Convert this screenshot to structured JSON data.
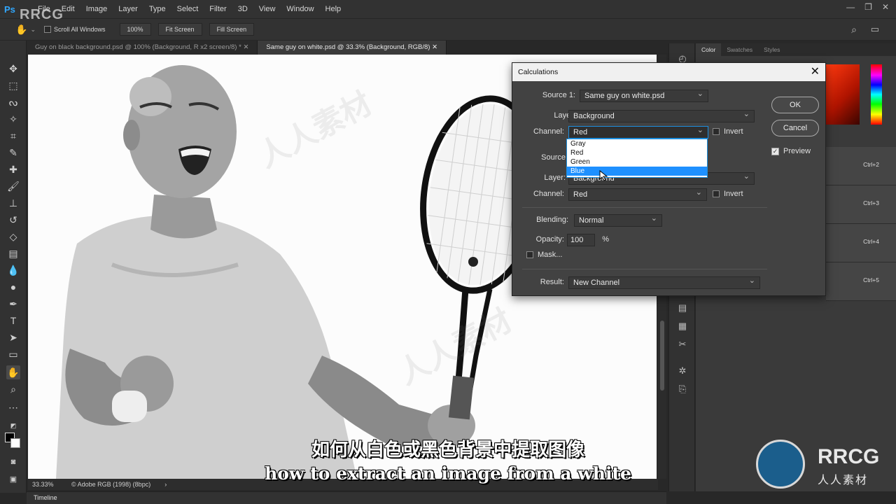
{
  "app": {
    "logo": "Ps"
  },
  "menu": [
    "File",
    "Edit",
    "Image",
    "Layer",
    "Type",
    "Select",
    "Filter",
    "3D",
    "View",
    "Window",
    "Help"
  ],
  "options_bar": {
    "scroll_all_windows": "Scroll All Windows",
    "zoom_100": "100%",
    "fit_screen": "Fit Screen",
    "fill_screen": "Fill Screen"
  },
  "doc_tabs": [
    {
      "label": "Guy on black background.psd @ 100% (Background, R x2 screen/8) *  ✕",
      "active": false
    },
    {
      "label": "Same guy on white.psd @ 33.3% (Background, RGB/8)  ✕",
      "active": true
    }
  ],
  "status": {
    "zoom": "33.33%",
    "profile": "© Adobe RGB (1998) (8bpc)",
    "arrow": "›"
  },
  "timeline": "Timeline",
  "right_panel": {
    "tabs": [
      "Color",
      "Swatches",
      "Styles"
    ],
    "actions": [
      "Ctrl+2",
      "Ctrl+3",
      "Ctrl+4",
      "Ctrl+5"
    ]
  },
  "dialog": {
    "title": "Calculations",
    "source1": {
      "label": "Source 1:",
      "value": "Same guy on white.psd"
    },
    "layer1": {
      "label": "Layer:",
      "value": "Background"
    },
    "channel1": {
      "label": "Channel:",
      "value": "Red",
      "invert": "Invert"
    },
    "source2": {
      "label": "Source"
    },
    "layer2": {
      "label": "Layer:",
      "value": "Background"
    },
    "channel2": {
      "label": "Channel:",
      "value": "Red",
      "invert": "Invert"
    },
    "blending": {
      "label": "Blending:",
      "value": "Normal"
    },
    "opacity": {
      "label": "Opacity:",
      "value": "100",
      "unit": "%"
    },
    "mask": "Mask...",
    "result": {
      "label": "Result:",
      "value": "New Channel"
    },
    "ok": "OK",
    "cancel": "Cancel",
    "preview": "Preview",
    "channel_options": [
      "Gray",
      "Red",
      "Green",
      "Blue"
    ],
    "highlighted_option": "Blue"
  },
  "subtitles": {
    "cn": "如何从白色或黑色背景中提取图像",
    "en": "how to extract an image from a white"
  },
  "watermarks": {
    "top_left": "RRCG",
    "brand": "RRCG",
    "brand_cn": "人人素材",
    "diag": "人人素材"
  },
  "colors": {
    "accent": "#1e90ff",
    "ui_dark": "#323232",
    "dialog_bg": "#424242"
  }
}
